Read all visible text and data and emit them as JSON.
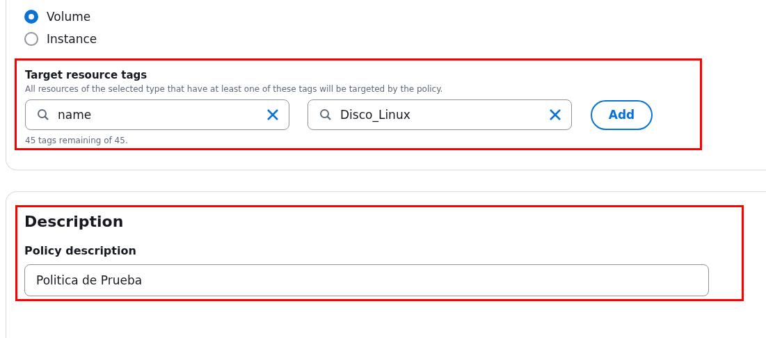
{
  "resource_type": {
    "options": [
      {
        "label": "Volume",
        "selected": true
      },
      {
        "label": "Instance",
        "selected": false
      }
    ]
  },
  "target_tags": {
    "title": "Target resource tags",
    "description": "All resources of the selected type that have at least one of these tags will be targeted by the policy.",
    "key": "name",
    "value": "Disco_Linux",
    "add_button": "Add",
    "remaining": "45 tags remaining of 45.",
    "highlighted": true
  },
  "description_section": {
    "title": "Description",
    "label": "Policy description",
    "value": "Politica de Prueba",
    "highlighted": true
  }
}
